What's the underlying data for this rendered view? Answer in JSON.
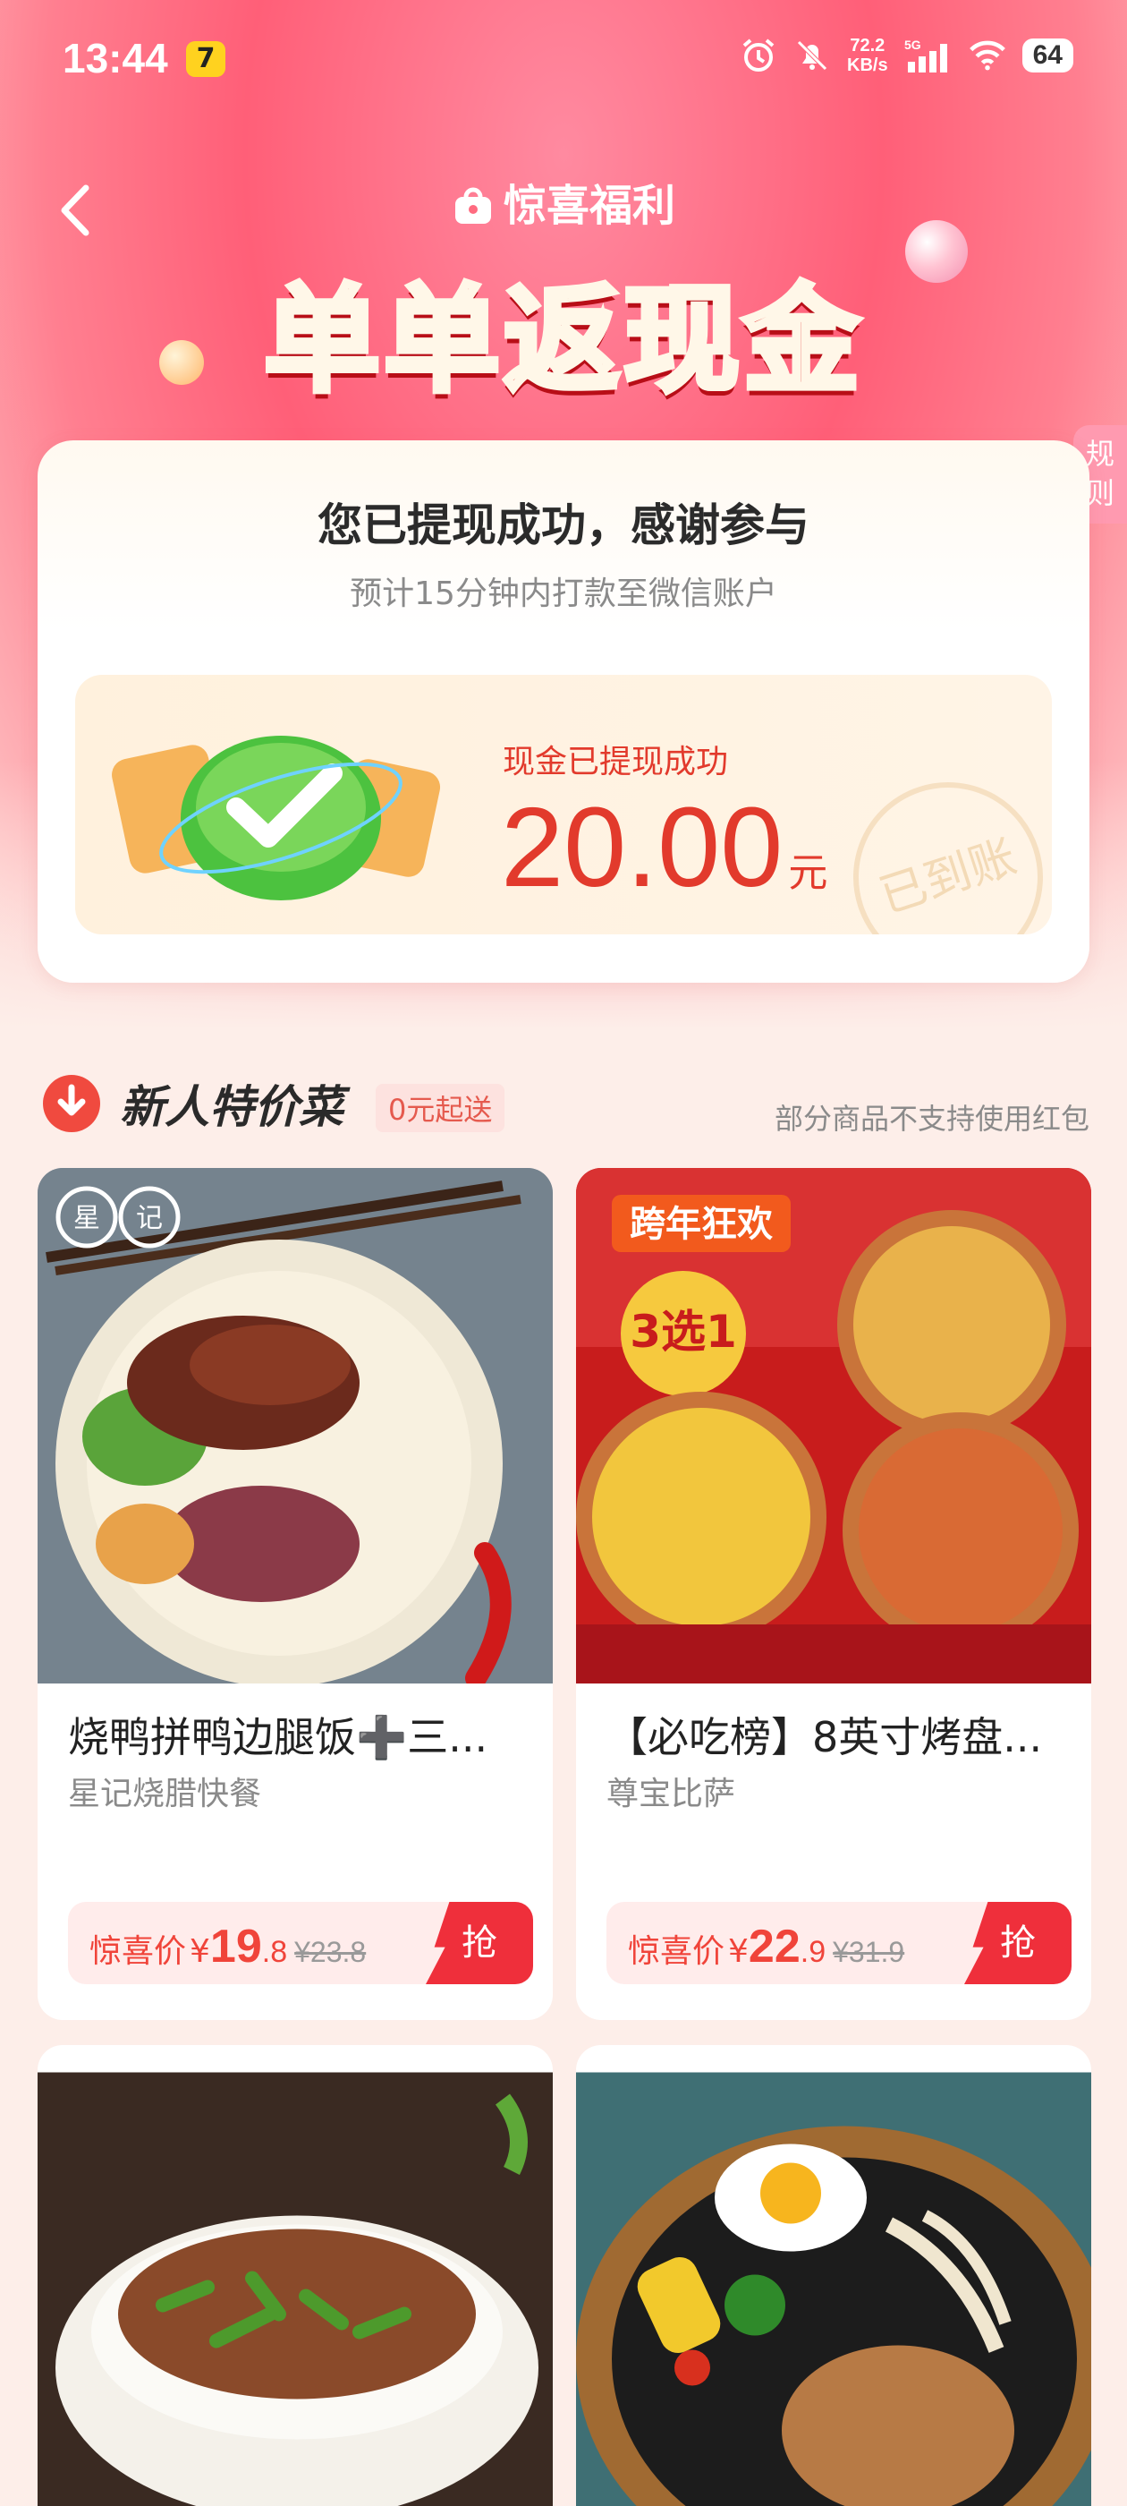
{
  "status_bar": {
    "time": "13:44",
    "app_badge": "7",
    "net_speed": "72.2",
    "net_unit": "KB/s",
    "signal": "5G",
    "battery": "64"
  },
  "header": {
    "subtitle": "惊喜福利",
    "title": "单单返现金",
    "rules_tab": "规则"
  },
  "success_card": {
    "title": "您已提现成功，感谢参与",
    "subtitle": "预计15分钟内打款至微信账户",
    "cash_label": "现金已提现成功",
    "amount": "20.00",
    "unit": "元",
    "stamp": "已到账"
  },
  "section": {
    "title": "新人特价菜",
    "pill": "0元起送",
    "note": "部分商品不支持使用红包"
  },
  "products": [
    {
      "name": "烧鸭拼鸭边腿饭➕三...",
      "shop": "星记烧腊快餐",
      "price_label": "惊喜价",
      "currency": "¥",
      "price_int": "19",
      "price_dec": ".8",
      "orig_price": "¥23.8",
      "grab": "抢"
    },
    {
      "name": "【必吃榜】8英寸烤盘...",
      "shop": "尊宝比萨",
      "price_label": "惊喜价",
      "currency": "¥",
      "price_int": "22",
      "price_dec": ".9",
      "orig_price": "¥31.9",
      "grab": "抢"
    }
  ],
  "promo_text": {
    "left_logo": "星记",
    "pizza_banner": "跨年狂欢",
    "pizza_badge": "3选1"
  }
}
